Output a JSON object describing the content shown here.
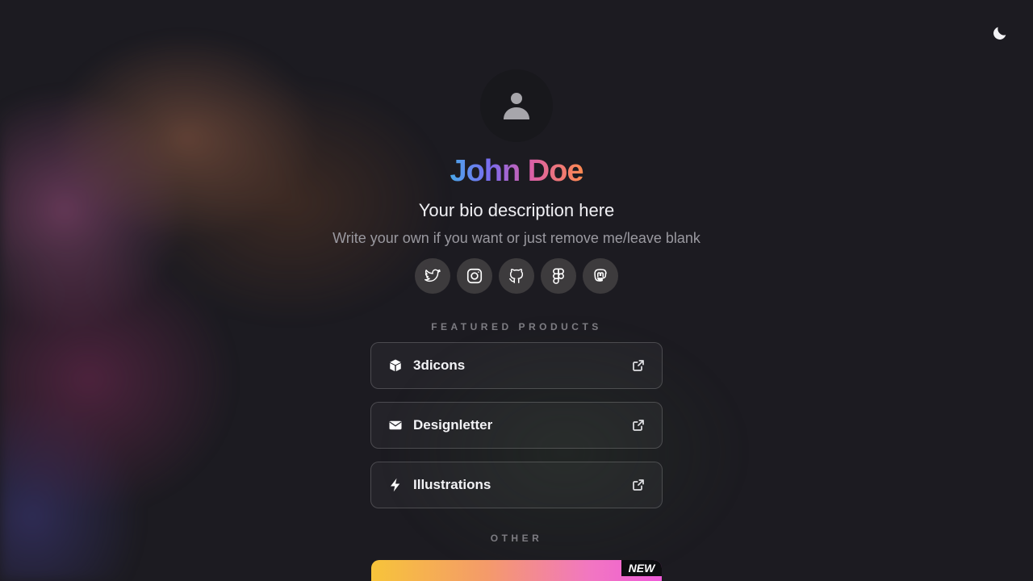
{
  "profile": {
    "name": "John Doe",
    "bio": "Your bio description here",
    "subbio": "Write your own if you want or just remove me/leave blank"
  },
  "socials": [
    {
      "icon": "twitter-icon"
    },
    {
      "icon": "instagram-icon"
    },
    {
      "icon": "github-icon"
    },
    {
      "icon": "figma-icon"
    },
    {
      "icon": "mastodon-icon"
    }
  ],
  "featured": {
    "label": "FEATURED PRODUCTS",
    "items": [
      {
        "label": "3dicons",
        "icon": "cube-icon"
      },
      {
        "label": "Designletter",
        "icon": "envelope-icon"
      },
      {
        "label": "Illustrations",
        "icon": "bolt-icon"
      }
    ]
  },
  "other": {
    "label": "OTHER",
    "badge": "NEW"
  },
  "colors": {
    "background": "#1c1b21",
    "name_gradient": [
      "#4aa8ea",
      "#7a6cf0",
      "#d95fa8",
      "#ff8a50"
    ],
    "banner_gradient": [
      "#f7c43a",
      "#f49a6a",
      "#f277c1",
      "#ef5ad8"
    ]
  }
}
